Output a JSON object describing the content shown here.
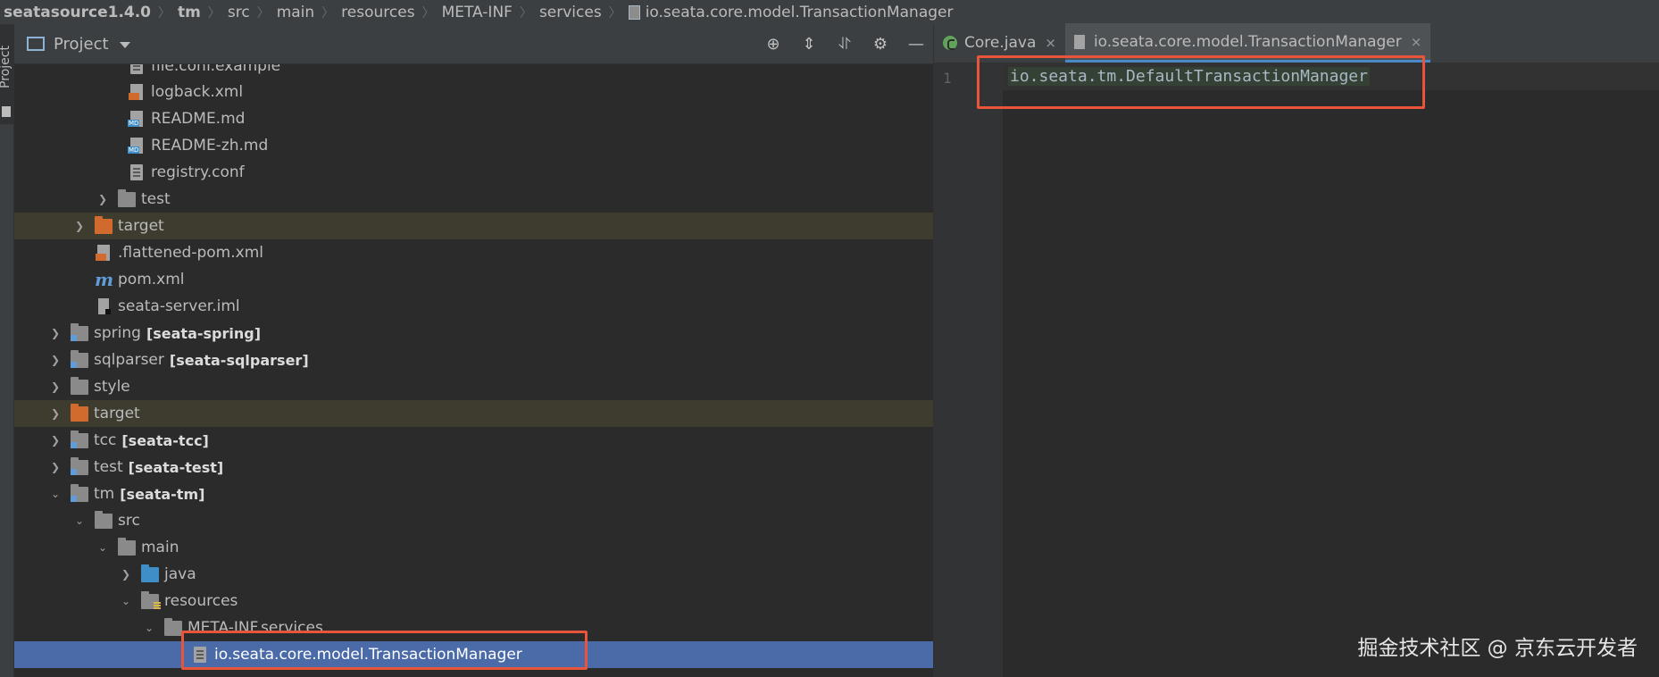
{
  "breadcrumb": {
    "items": [
      "seatasource1.4.0",
      "tm",
      "src",
      "main",
      "resources",
      "META-INF",
      "services",
      "io.seata.core.model.TransactionManager"
    ]
  },
  "tool_strip": {
    "label": "Project"
  },
  "project_panel": {
    "title": "Project",
    "tools": [
      "locate-icon",
      "expand-all-icon",
      "collapse-all-icon",
      "gear-icon",
      "minimize-icon"
    ]
  },
  "tree": {
    "rows": [
      {
        "label": "file.conf.example"
      },
      {
        "label": "logback.xml"
      },
      {
        "label": "README.md"
      },
      {
        "label": "README-zh.md"
      },
      {
        "label": "registry.conf"
      },
      {
        "label": "test"
      },
      {
        "label": "target"
      },
      {
        "label": ".flattened-pom.xml"
      },
      {
        "label": "pom.xml"
      },
      {
        "label": "seata-server.iml"
      },
      {
        "label": "spring",
        "module": "[seata-spring]"
      },
      {
        "label": "sqlparser",
        "module": "[seata-sqlparser]"
      },
      {
        "label": "style"
      },
      {
        "label": "target"
      },
      {
        "label": "tcc",
        "module": "[seata-tcc]"
      },
      {
        "label": "test",
        "module": "[seata-test]"
      },
      {
        "label": "tm",
        "module": "[seata-tm]"
      },
      {
        "label": "src"
      },
      {
        "label": "main"
      },
      {
        "label": "java"
      },
      {
        "label": "resources"
      },
      {
        "label": "META-INF.services"
      },
      {
        "label": "io.seata.core.model.TransactionManager"
      }
    ]
  },
  "editor": {
    "tabs": [
      {
        "label": "Core.java",
        "close": "×"
      },
      {
        "label": "io.seata.core.model.TransactionManager",
        "close": "×"
      }
    ],
    "line_number": "1",
    "code_line": "io.seata.tm.DefaultTransactionManager"
  },
  "watermark": "掘金技术社区 @ 京东云开发者",
  "colors": {
    "background": "#2b2b2b",
    "panel": "#3c3f41",
    "selection": "#4a6aa8",
    "highlight_row": "#3e3b2f",
    "annotation_red": "#e8553a"
  }
}
